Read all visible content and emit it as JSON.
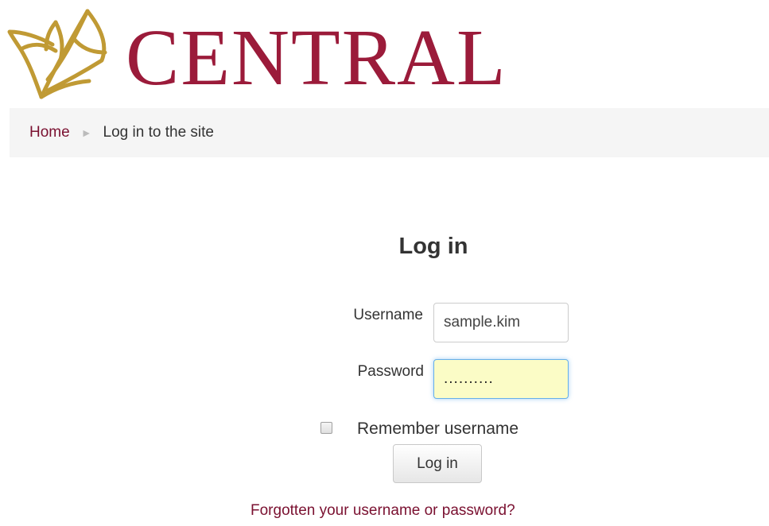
{
  "brand": {
    "name": "CENTRAL",
    "primary_color": "#9b1b3a",
    "logo_accent": "#c09a34",
    "logo_icon": "leaf-logo-icon"
  },
  "breadcrumb": {
    "home": "Home",
    "separator_icon": "triangle-right-icon",
    "current": "Log in to the site"
  },
  "page": {
    "heading": "Log in"
  },
  "form": {
    "username_label": "Username",
    "username_value": "sample.kim",
    "password_label": "Password",
    "password_value": "..........",
    "remember_label": "Remember username",
    "remember_checked": false,
    "submit_label": "Log in",
    "forgot_link": "Forgotten your username or password?"
  }
}
